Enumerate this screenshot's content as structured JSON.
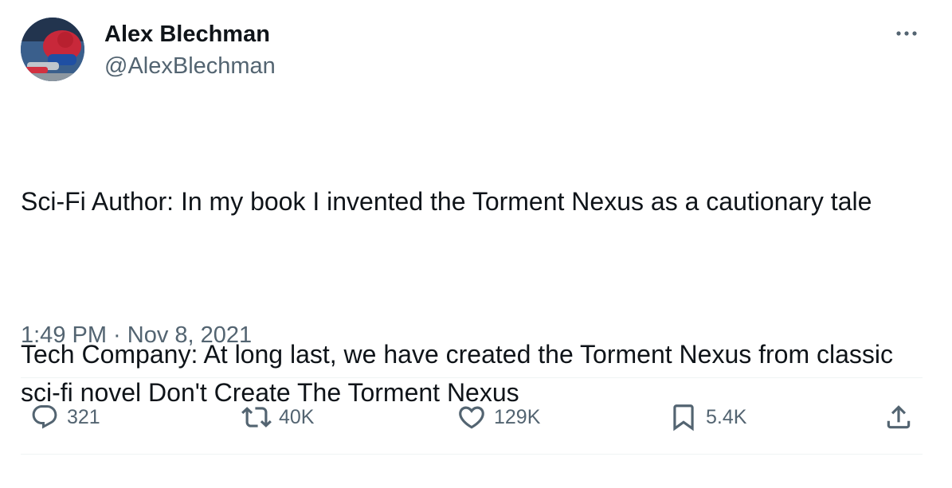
{
  "author": {
    "display_name": "Alex Blechman",
    "handle": "@AlexBlechman",
    "avatar_icon": "avatar-spider-man"
  },
  "more_icon": "more-dots-icon",
  "tweet": {
    "paragraphs": [
      "Sci-Fi Author: In my book I invented the Torment Nexus as a cautionary tale",
      "Tech Company: At long last, we have created the Torment Nexus from classic sci-fi novel Don't Create The Torment Nexus"
    ],
    "timestamp": "1:49 PM · Nov 8, 2021"
  },
  "actions": {
    "reply": {
      "icon": "reply-icon",
      "count": "321"
    },
    "retweet": {
      "icon": "retweet-icon",
      "count": "40K"
    },
    "like": {
      "icon": "heart-icon",
      "count": "129K"
    },
    "bookmark": {
      "icon": "bookmark-icon",
      "count": "5.4K"
    },
    "share": {
      "icon": "share-icon"
    }
  },
  "colors": {
    "text_primary": "#0f1419",
    "text_secondary": "#536471",
    "divider": "#eff3f4"
  }
}
